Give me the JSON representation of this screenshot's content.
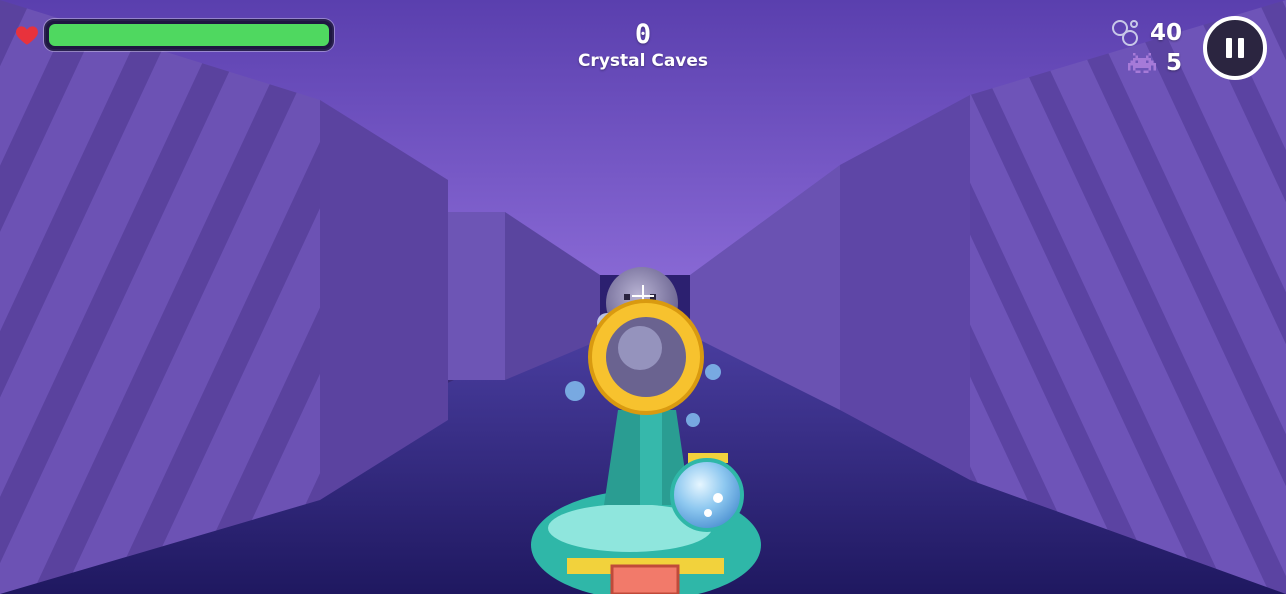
{
  "hud": {
    "health": {
      "fraction": 1.0,
      "heart_icon": "heart-icon",
      "fill_color": "#4fd860"
    },
    "score": "0",
    "level_name": "Crystal Caves",
    "bubbles": {
      "icon": "bubbles-icon",
      "value": "40"
    },
    "enemies": {
      "icon": "space-invader-icon",
      "value": "5"
    },
    "pause_icon": "pause-icon"
  },
  "scene": {
    "ceiling_color": "#6a4fbf",
    "floor_color": "#2e2478",
    "wall_color": "#6e54b6",
    "weapon": "bubble-blaster"
  }
}
